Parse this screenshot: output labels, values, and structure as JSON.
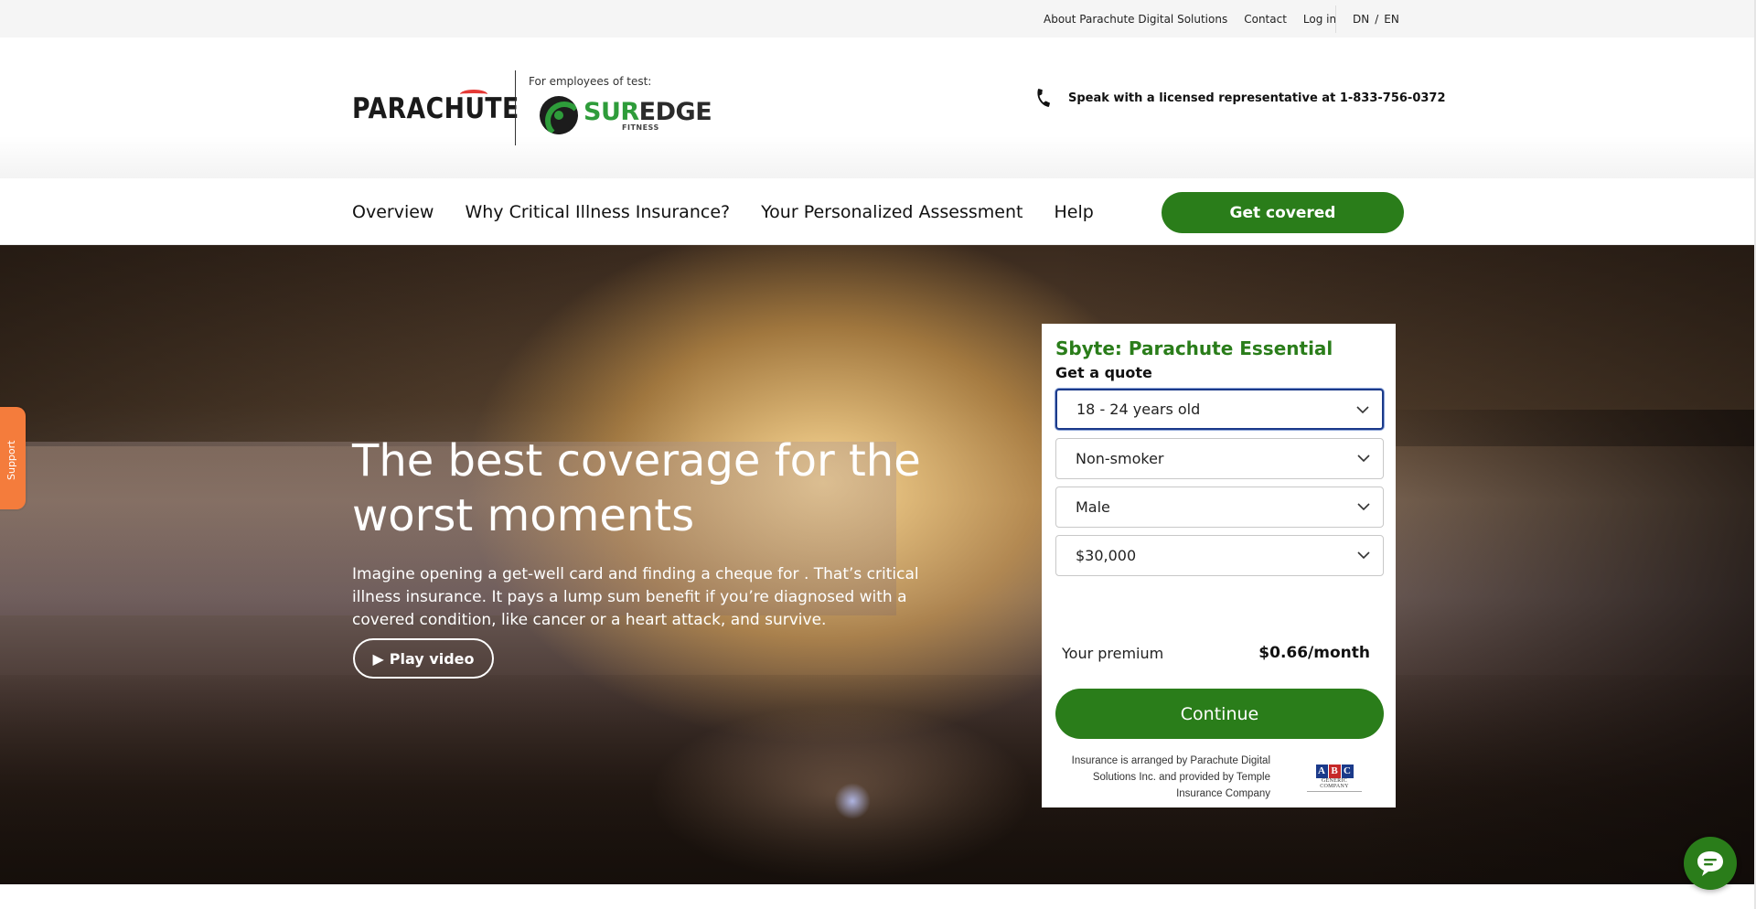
{
  "utility_bar": {
    "links": [
      "About Parachute Digital Solutions",
      "Contact",
      "Log in"
    ],
    "languages": [
      "DN",
      "EN"
    ],
    "lang_separator": "/"
  },
  "header": {
    "brand": "PARACHUTE",
    "employees_label": "For employees of test:",
    "partner": {
      "name_part1": "SUR",
      "name_part2": "EDGE",
      "subtitle": "FITNESS"
    },
    "phone_text": "Speak with a licensed representative at 1-833-756-0372"
  },
  "nav": {
    "items": [
      "Overview",
      "Why Critical Illness Insurance?",
      "Your Personalized Assessment",
      "Help"
    ],
    "cta": "Get covered"
  },
  "hero": {
    "title": "The best coverage for the worst moments",
    "body": "Imagine opening a get-well card and finding a cheque for . That’s critical illness insurance. It pays a lump sum benefit if you’re diagnosed with a covered condition, like cancer or a heart attack, and survive.",
    "play_label": "Play video",
    "play_glyph": "▶"
  },
  "support": {
    "label": "Support"
  },
  "quote": {
    "title": "Sbyte: Parachute Essential",
    "subtitle": "Get a quote",
    "age": "18 - 24 years old",
    "smoker": "Non-smoker",
    "gender": "Male",
    "amount": "$30,000",
    "premium_label": "Your premium",
    "premium_value": "$0.66/month",
    "continue": "Continue",
    "disclaimer": "Insurance is arranged by Parachute Digital Solutions Inc. and provided by Temple Insurance Company",
    "insurer_logo": {
      "letters": [
        "A",
        "B",
        "C"
      ],
      "subtitle": "GENERIC COMPANY"
    }
  },
  "colors": {
    "primary_green": "#2a7d1a",
    "support_orange": "#f47c3c",
    "focus_blue": "#1b3a8a",
    "abc_colors": [
      "#1b3a8a",
      "#c62828",
      "#1b3a8a"
    ]
  },
  "icons": {
    "phone": "phone-icon",
    "chevron": "chevron-down-icon",
    "chat": "chat-bubble-icon",
    "play": "play-icon"
  }
}
